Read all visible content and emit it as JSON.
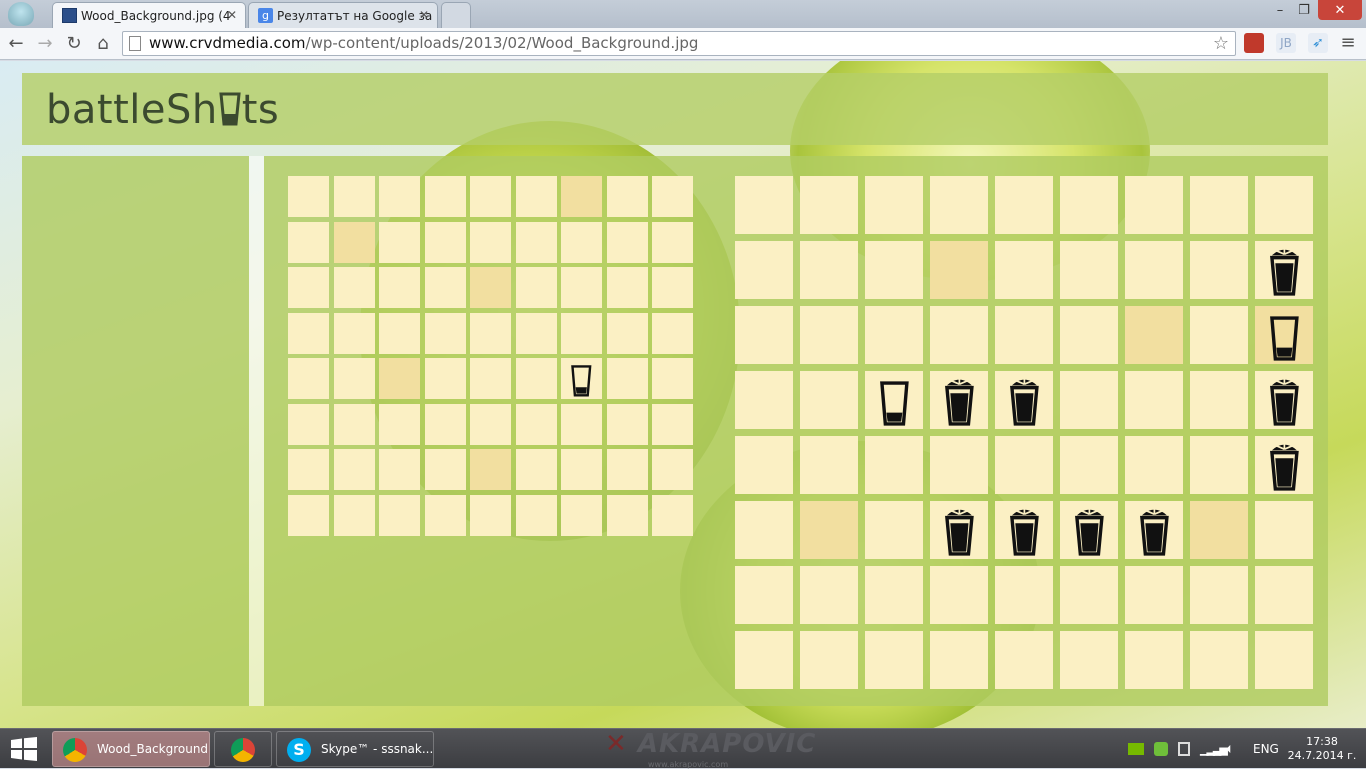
{
  "browser": {
    "tabs": [
      {
        "label": "Wood_Background.jpg (4",
        "active": true
      },
      {
        "label": "Резултатът на Google за ",
        "active": false
      }
    ],
    "url_host": "www.crvdmedia.com",
    "url_path": "/wp-content/uploads/2013/02/Wood_Background.jpg",
    "window_controls": [
      "–",
      "❐",
      "✕"
    ]
  },
  "app": {
    "logo_prefix": "battleSh",
    "logo_suffix": "ts",
    "small_grid": {
      "rows": 8,
      "cols": 9,
      "miss_cells": [
        [
          0,
          6
        ],
        [
          1,
          1
        ],
        [
          2,
          4
        ],
        [
          4,
          2
        ],
        [
          6,
          4
        ]
      ],
      "empty_glass": [
        [
          4,
          6
        ]
      ],
      "full_glass": []
    },
    "large_grid": {
      "rows": 8,
      "cols": 9,
      "miss_cells": [
        [
          1,
          3
        ],
        [
          2,
          6
        ],
        [
          2,
          8
        ],
        [
          5,
          1
        ],
        [
          5,
          7
        ]
      ],
      "empty_glass": [
        [
          2,
          8
        ],
        [
          3,
          2
        ]
      ],
      "full_glass": [
        [
          1,
          8
        ],
        [
          3,
          3
        ],
        [
          3,
          4
        ],
        [
          3,
          8
        ],
        [
          4,
          8
        ],
        [
          5,
          3
        ],
        [
          5,
          4
        ],
        [
          5,
          5
        ],
        [
          5,
          6
        ]
      ]
    }
  },
  "taskbar": {
    "items": [
      {
        "label": "Wood_Background...",
        "active": true,
        "icon": "chrome-icon"
      },
      {
        "label": "",
        "active": false,
        "icon": "chrome-icon"
      },
      {
        "label": "Skype™ - sssnak...",
        "active": false,
        "icon": "skype-icon"
      }
    ],
    "brand": "AKRAPOVIC",
    "brand_sub": "www.akrapovic.com",
    "lang": "ENG",
    "time": "17:38",
    "date": "24.7.2014 г."
  },
  "colors": {
    "cell": "#fbf0c4",
    "miss": "#f2dfa0",
    "panel": "#b0cc62"
  }
}
